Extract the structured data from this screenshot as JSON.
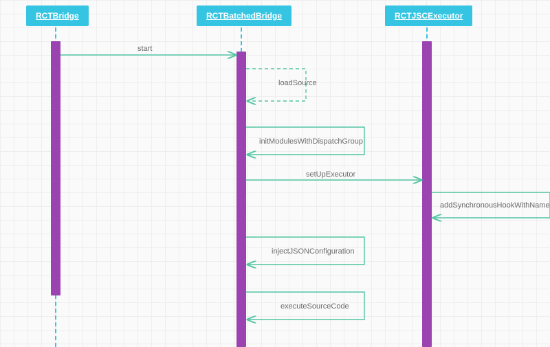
{
  "chart_data": {
    "type": "sequence",
    "participants": [
      "RCTBridge",
      "RCTBatchedBridge",
      "RCTJSCExecutor"
    ],
    "messages": [
      {
        "from": "RCTBridge",
        "to": "RCTBatchedBridge",
        "label": "start",
        "style": "solid"
      },
      {
        "from": "RCTBatchedBridge",
        "to": "RCTBatchedBridge",
        "label": "loadSource",
        "style": "dashed"
      },
      {
        "from": "RCTBatchedBridge",
        "to": "RCTBatchedBridge",
        "label": "initModulesWithDispatchGroup",
        "style": "solid"
      },
      {
        "from": "RCTBatchedBridge",
        "to": "RCTJSCExecutor",
        "label": "setUpExecutor",
        "style": "solid"
      },
      {
        "from": "RCTJSCExecutor",
        "to": "RCTJSCExecutor",
        "label": "addSynchronousHookWithName",
        "style": "solid"
      },
      {
        "from": "RCTBatchedBridge",
        "to": "RCTBatchedBridge",
        "label": "injectJSONConfiguration",
        "style": "solid"
      },
      {
        "from": "RCTBatchedBridge",
        "to": "RCTBatchedBridge",
        "label": "executeSourceCode",
        "style": "solid"
      }
    ]
  },
  "participants": {
    "p1": "RCTBridge",
    "p2": "RCTBatchedBridge",
    "p3": "RCTJSCExecutor"
  },
  "labels": {
    "start": "start",
    "loadSource": "loadSource",
    "initModules": "initModulesWithDispatchGroup",
    "setUpExecutor": "setUpExecutor",
    "addHook": "addSynchronousHookWithName",
    "injectJSON": "injectJSONConfiguration",
    "executeSource": "executeSourceCode"
  },
  "colors": {
    "participant_bg": "#35c5e2",
    "activation": "#9b43b1",
    "arrow": "#52c5a3"
  }
}
